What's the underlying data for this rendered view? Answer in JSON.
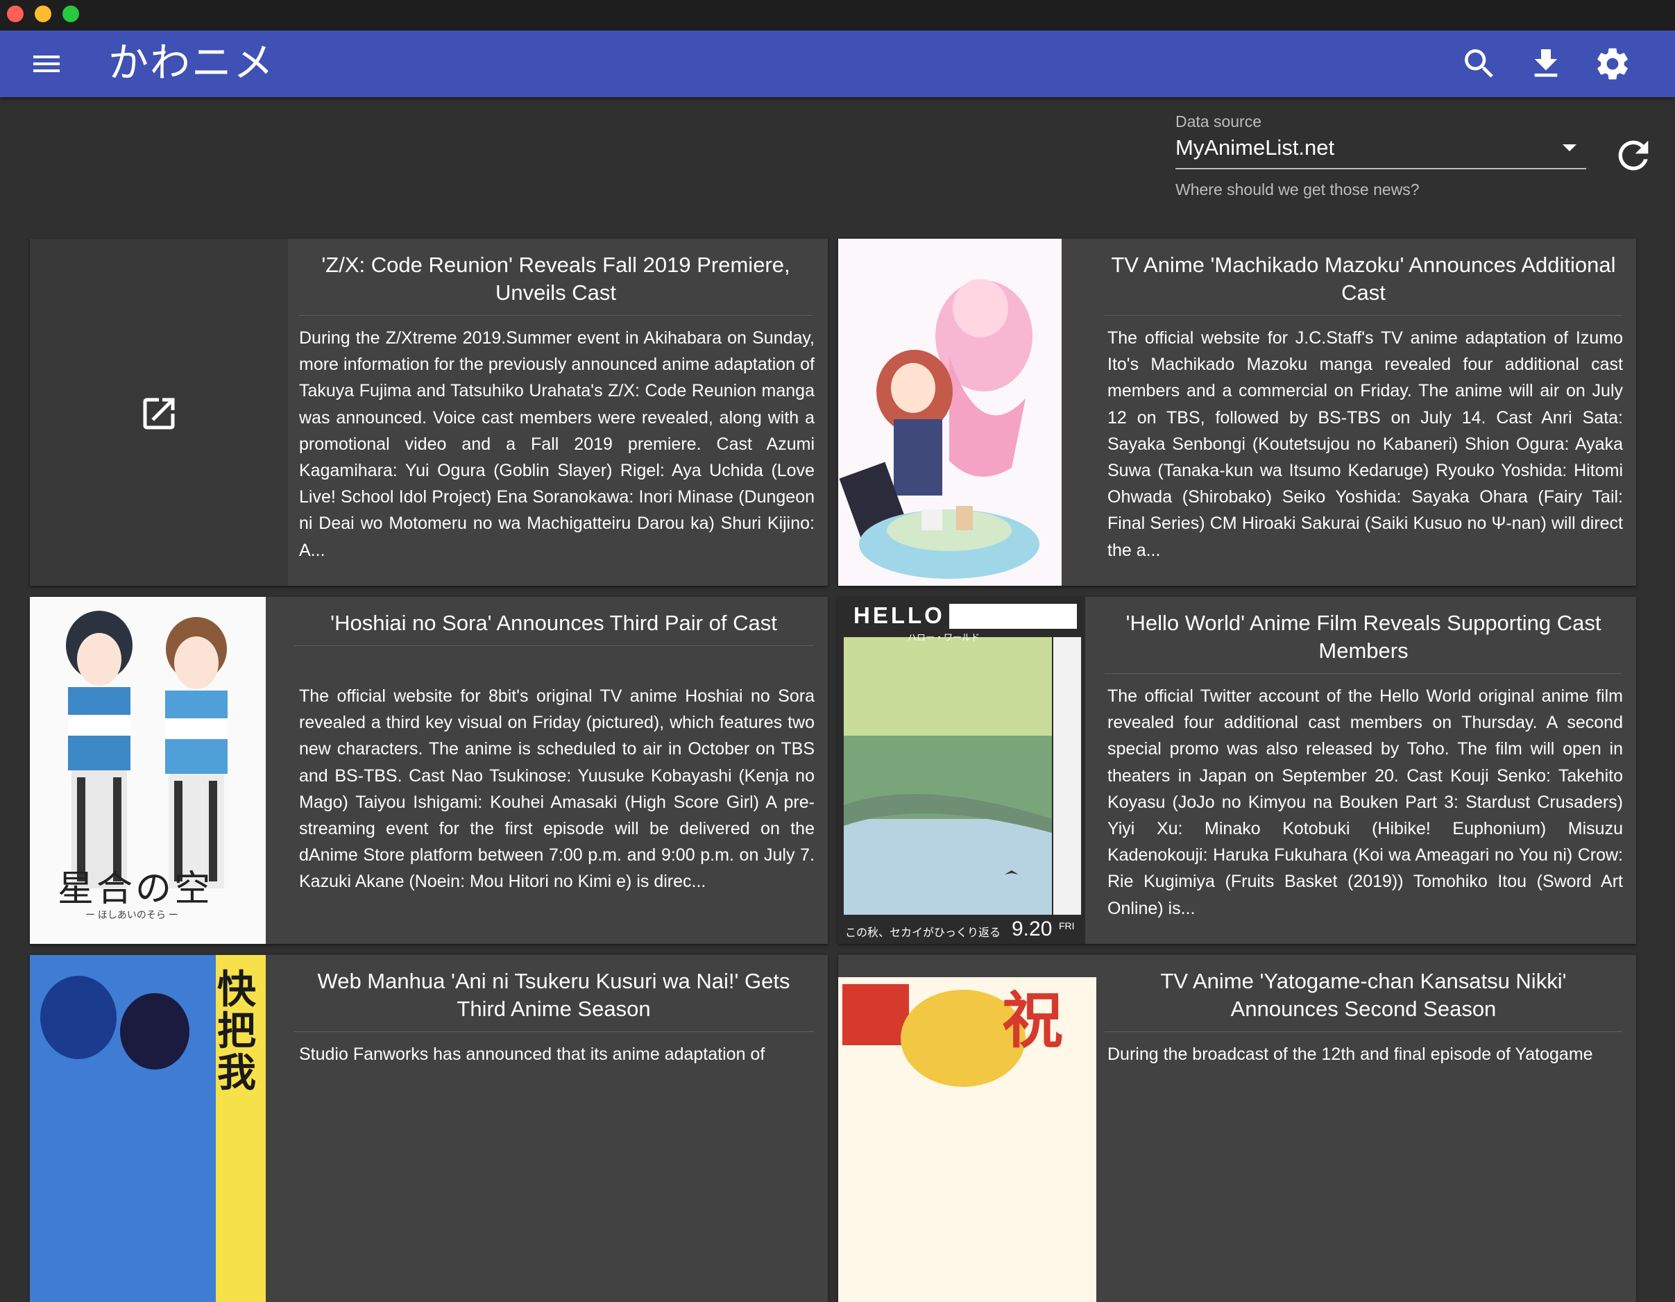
{
  "window": {
    "controls": [
      "close",
      "minimize",
      "maximize"
    ]
  },
  "appbar": {
    "title": "かわニメ",
    "icons": [
      "menu-icon",
      "search-icon",
      "download-icon",
      "settings-icon"
    ],
    "color": "#3f51b5"
  },
  "data_source": {
    "label": "Data source",
    "value": "MyAnimeList.net",
    "hint": "Where should we get those news?"
  },
  "articles": [
    {
      "title": "'Z/X: Code Reunion' Reveals Fall 2019 Premiere, Unveils Cast",
      "body": "During the Z/Xtreme 2019.Summer event in Akihabara on Sunday, more information for the previously announced anime adaptation of Takuya Fujima and Tatsuhiko Urahata's Z/X: Code Reunion manga was announced. Voice cast members were revealed, along with a promotional video and a Fall 2019 premiere. Cast Azumi Kagamihara: Yui Ogura (Goblin Slayer) Rigel: Aya Uchida (Love Live! School Idol Project) Ena Soranokawa: Inori Minase (Dungeon ni Deai wo Motomeru no wa Machigatteiru Darou ka) Shuri Kijino: A...",
      "image": "open-in-new-icon"
    },
    {
      "title": "TV Anime 'Machikado Mazoku' Announces Additional Cast",
      "body": "The official website for J.C.Staff's TV anime adaptation of Izumo Ito's Machikado Mazoku manga revealed four additional cast members and a commercial on Friday. The anime will air on July 12 on TBS, followed by BS-TBS on July 14. Cast Anri Sata: Sayaka Senbongi (Koutetsujou no Kabaneri) Shion Ogura: Ayaka Suwa (Tanaka-kun wa Itsumo Kedaruge) Ryouko Yoshida: Hitomi Ohwada (Shirobako) Seiko Yoshida: Sayaka Ohara (Fairy Tail: Final Series) CM Hiroaki Sakurai (Saiki Kusuo no Ψ-nan) will direct the a...",
      "image": "machikado-mazoku-visual"
    },
    {
      "title": "'Hoshiai no Sora' Announces Third Pair of Cast",
      "body": "The official website for 8bit's original TV anime Hoshiai no Sora revealed a third key visual on Friday (pictured), which features two new characters. The anime is scheduled to air in October on TBS and BS-TBS. Cast Nao Tsukinose: Yuusuke Kobayashi (Kenja no Mago) Taiyou Ishigami: Kouhei Amasaki (High Score Girl) A pre-streaming event for the first episode will be delivered on the dAnime Store platform between 7:00 p.m. and 9:00 p.m. on July 7. Kazuki Akane (Noein: Mou Hitori no Kimi e) is direc...",
      "image": "hoshiai-no-sora-visual",
      "image_text": "星合の空",
      "image_subtext": "ー ほしあいのそら ー"
    },
    {
      "title": "'Hello World' Anime Film Reveals Supporting Cast Members",
      "body": "The official Twitter account of the Hello World original anime film revealed four additional cast members on Thursday. A second special promo was also released by Toho. The film will open in theaters in Japan on September 20. Cast Kouji Senko: Takehito Koyasu (JoJo no Kimyou na Bouken Part 3: Stardust Crusaders) Yiyi Xu: Minako Kotobuki (Hibike! Euphonium) Misuzu Kadenokouji: Haruka Fukuhara (Koi wa Ameagari no You ni) Crow: Rie Kugimiya (Fruits Basket (2019)) Tomohiko Itou (Sword Art Online) is...",
      "image": "hello-world-poster",
      "image_text": "HELLO WORLD",
      "image_subtext": "ハロー・ワールド",
      "image_footer": "この秋、セカイがひっくり返る",
      "image_date": "9.20",
      "image_date_suffix": "FRI"
    },
    {
      "title": "Web Manhua 'Ani ni Tsukeru Kusuri wa Nai!' Gets Third Anime Season",
      "body": "Studio Fanworks has announced that its anime adaptation of",
      "image": "ani-ni-tsukeru-visual",
      "image_text": "快把我"
    },
    {
      "title": "TV Anime 'Yatogame-chan Kansatsu Nikki' Announces Second Season",
      "body": "During the broadcast of the 12th and final episode of Yatogame",
      "image": "yatogame-chan-visual",
      "image_text": "祝"
    }
  ]
}
